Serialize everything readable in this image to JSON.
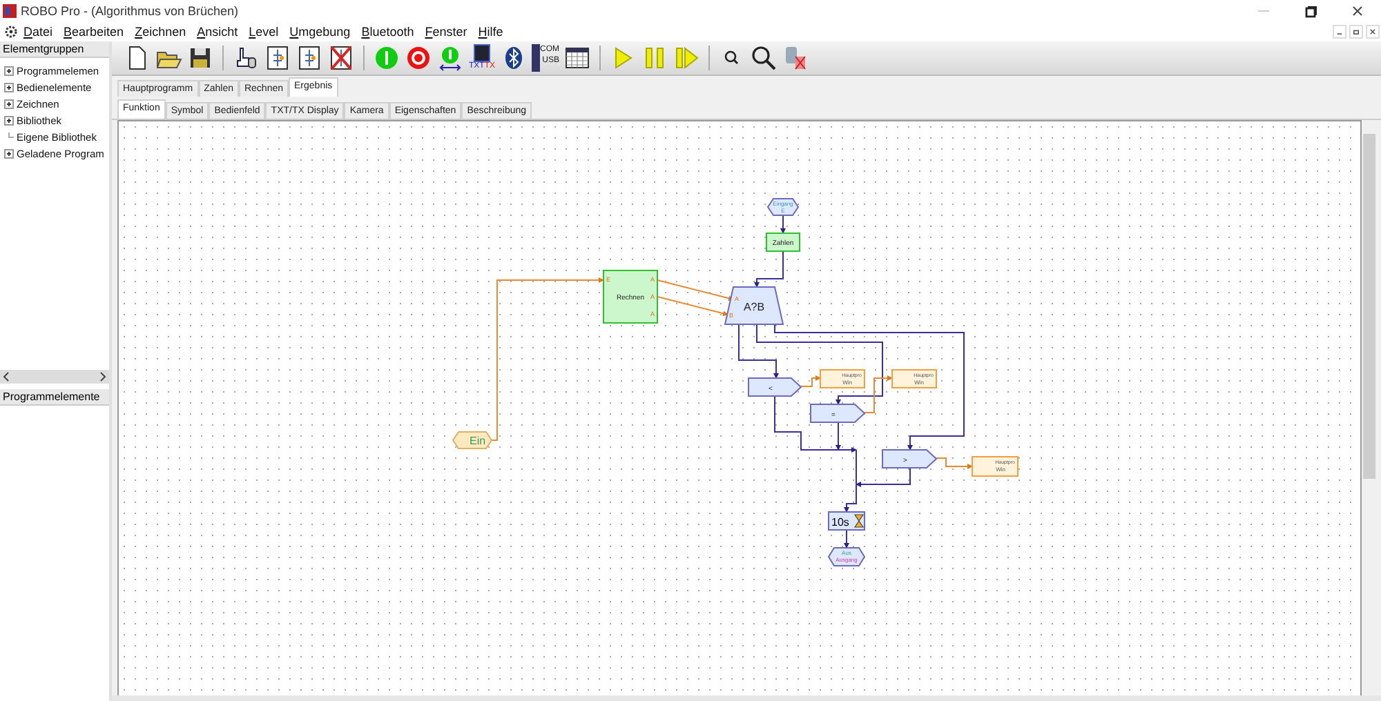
{
  "window": {
    "title": "ROBO Pro - (Algorithmus von Brüchen)"
  },
  "menu": [
    {
      "label": "Datei"
    },
    {
      "label": "Bearbeiten"
    },
    {
      "label": "Zeichnen"
    },
    {
      "label": "Ansicht"
    },
    {
      "label": "Level"
    },
    {
      "label": "Umgebung"
    },
    {
      "label": "Bluetooth"
    },
    {
      "label": "Fenster"
    },
    {
      "label": "Hilfe"
    }
  ],
  "sidebar": {
    "header": "Elementgruppen",
    "tree": [
      {
        "label": "Programmelemen",
        "expandable": true
      },
      {
        "label": "Bedienelemente",
        "expandable": true
      },
      {
        "label": "Zeichnen",
        "expandable": true
      },
      {
        "label": "Bibliothek",
        "expandable": true
      },
      {
        "label": "Eigene Bibliothek",
        "expandable": false
      },
      {
        "label": "Geladene Program",
        "expandable": true
      }
    ],
    "lower_header": "Programmelemente"
  },
  "toolbar": [
    {
      "kind": "new"
    },
    {
      "kind": "open"
    },
    {
      "kind": "save"
    },
    {
      "sep": true,
      "kind": "pointer"
    },
    {
      "kind": "flow"
    },
    {
      "kind": "flow2"
    },
    {
      "kind": "delete"
    },
    {
      "sep": true,
      "kind": "start"
    },
    {
      "kind": "stop"
    },
    {
      "kind": "download"
    },
    {
      "kind": "chip",
      "labels": [
        "TXT",
        "TX"
      ]
    },
    {
      "kind": "bluetooth"
    },
    {
      "kind": "port",
      "labels": [
        "COM",
        "USB"
      ]
    },
    {
      "kind": "table"
    },
    {
      "sep": true,
      "kind": "play"
    },
    {
      "kind": "pause"
    },
    {
      "kind": "step"
    },
    {
      "sep": true,
      "kind": "zoom-small"
    },
    {
      "kind": "zoom-large"
    },
    {
      "kind": "disconnect"
    }
  ],
  "subprogram_tabs": [
    {
      "label": "Hauptprogramm",
      "selected": false
    },
    {
      "label": "Zahlen",
      "selected": false
    },
    {
      "label": "Rechnen",
      "selected": false
    },
    {
      "label": "Ergebnis",
      "selected": true
    }
  ],
  "view_tabs": [
    {
      "label": "Funktion",
      "selected": true
    },
    {
      "label": "Symbol",
      "selected": false
    },
    {
      "label": "Bedienfeld",
      "selected": false
    },
    {
      "label": "TXT/TX Display",
      "selected": false
    },
    {
      "label": "Kamera",
      "selected": false
    },
    {
      "label": "Eigenschaften",
      "selected": false
    },
    {
      "label": "Beschreibung",
      "selected": false
    }
  ],
  "diagram": {
    "nodes": [
      {
        "kind": "input",
        "texts": [
          "Eingang",
          "E"
        ]
      },
      {
        "kind": "sub",
        "texts": [
          "Zahlen"
        ]
      },
      {
        "kind": "subport",
        "texts": [
          "Rechnen",
          "E",
          "A",
          "A",
          "A"
        ]
      },
      {
        "kind": "compare",
        "texts": [
          "A?B",
          "A",
          "B"
        ]
      },
      {
        "kind": "branch",
        "texts": [
          "<"
        ]
      },
      {
        "kind": "branch",
        "texts": [
          "="
        ]
      },
      {
        "kind": "branch",
        "texts": [
          ">"
        ]
      },
      {
        "kind": "var",
        "texts": [
          "Hauptpro",
          "Win"
        ]
      },
      {
        "kind": "var",
        "texts": [
          "Hauptpro",
          "Win"
        ]
      },
      {
        "kind": "var",
        "texts": [
          "Hauptpro",
          "Win"
        ]
      },
      {
        "kind": "wait",
        "texts": [
          "10s"
        ]
      },
      {
        "kind": "output",
        "texts": [
          "Aus",
          "Ausgang"
        ]
      },
      {
        "kind": "start",
        "texts": [
          "Ein"
        ]
      }
    ]
  }
}
